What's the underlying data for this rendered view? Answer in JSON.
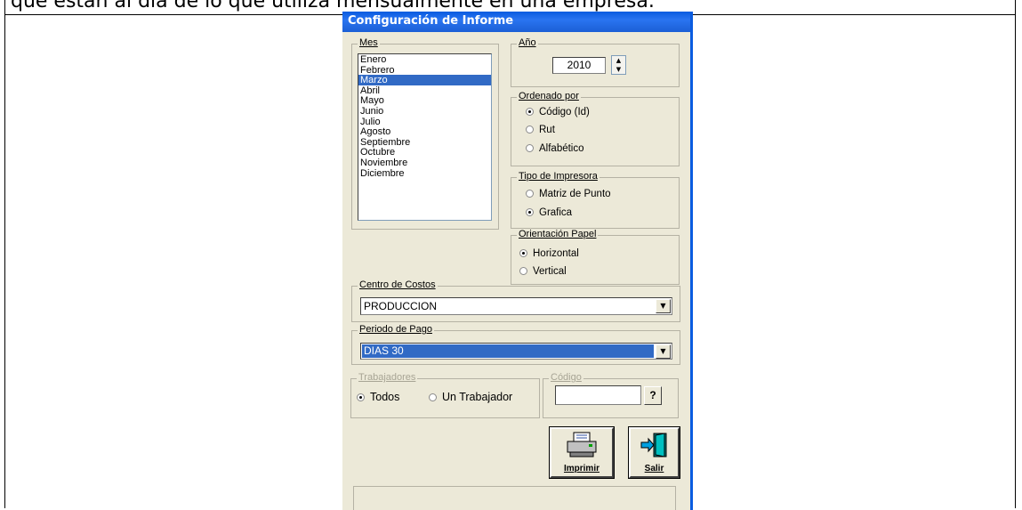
{
  "background_text": "que están al día de lo que utiliza mensualmente en una empresa.",
  "dialog": {
    "title": "Configuración de Informe",
    "mes": {
      "legend": "Mes",
      "items": [
        "Enero",
        "Febrero",
        "Marzo",
        "Abril",
        "Mayo",
        "Junio",
        "Julio",
        "Agosto",
        "Septiembre",
        "Octubre",
        "Noviembre",
        "Diciembre"
      ],
      "selected": "Marzo"
    },
    "anio": {
      "legend": "Año",
      "value": "2010"
    },
    "ordenado_por": {
      "legend": "Ordenado por",
      "options": [
        "Código (Id)",
        "Rut",
        "Alfabético"
      ],
      "selected": "Código (Id)"
    },
    "tipo_impresora": {
      "legend": "Tipo de Impresora",
      "options": [
        "Matriz de Punto",
        "Grafica"
      ],
      "selected": "Grafica"
    },
    "orientacion": {
      "legend": "Orientación Papel",
      "options": [
        "Horizontal",
        "Vertical"
      ],
      "selected": "Horizontal"
    },
    "centro_costos": {
      "legend": "Centro de Costos",
      "value": "PRODUCCION"
    },
    "periodo_pago": {
      "legend": "Periodo de Pago",
      "value": "DIAS 30"
    },
    "trabajadores": {
      "legend": "Trabajadores",
      "options": [
        "Todos",
        "Un Trabajador"
      ],
      "selected": "Todos"
    },
    "codigo": {
      "legend": "Código",
      "value": "",
      "lookup_label": "?"
    },
    "buttons": {
      "print": "Imprimir",
      "exit": "Salir"
    },
    "colors": {
      "title_bar": "#0a5ce0",
      "selection": "#316ac5",
      "face": "#ece9d8"
    }
  }
}
